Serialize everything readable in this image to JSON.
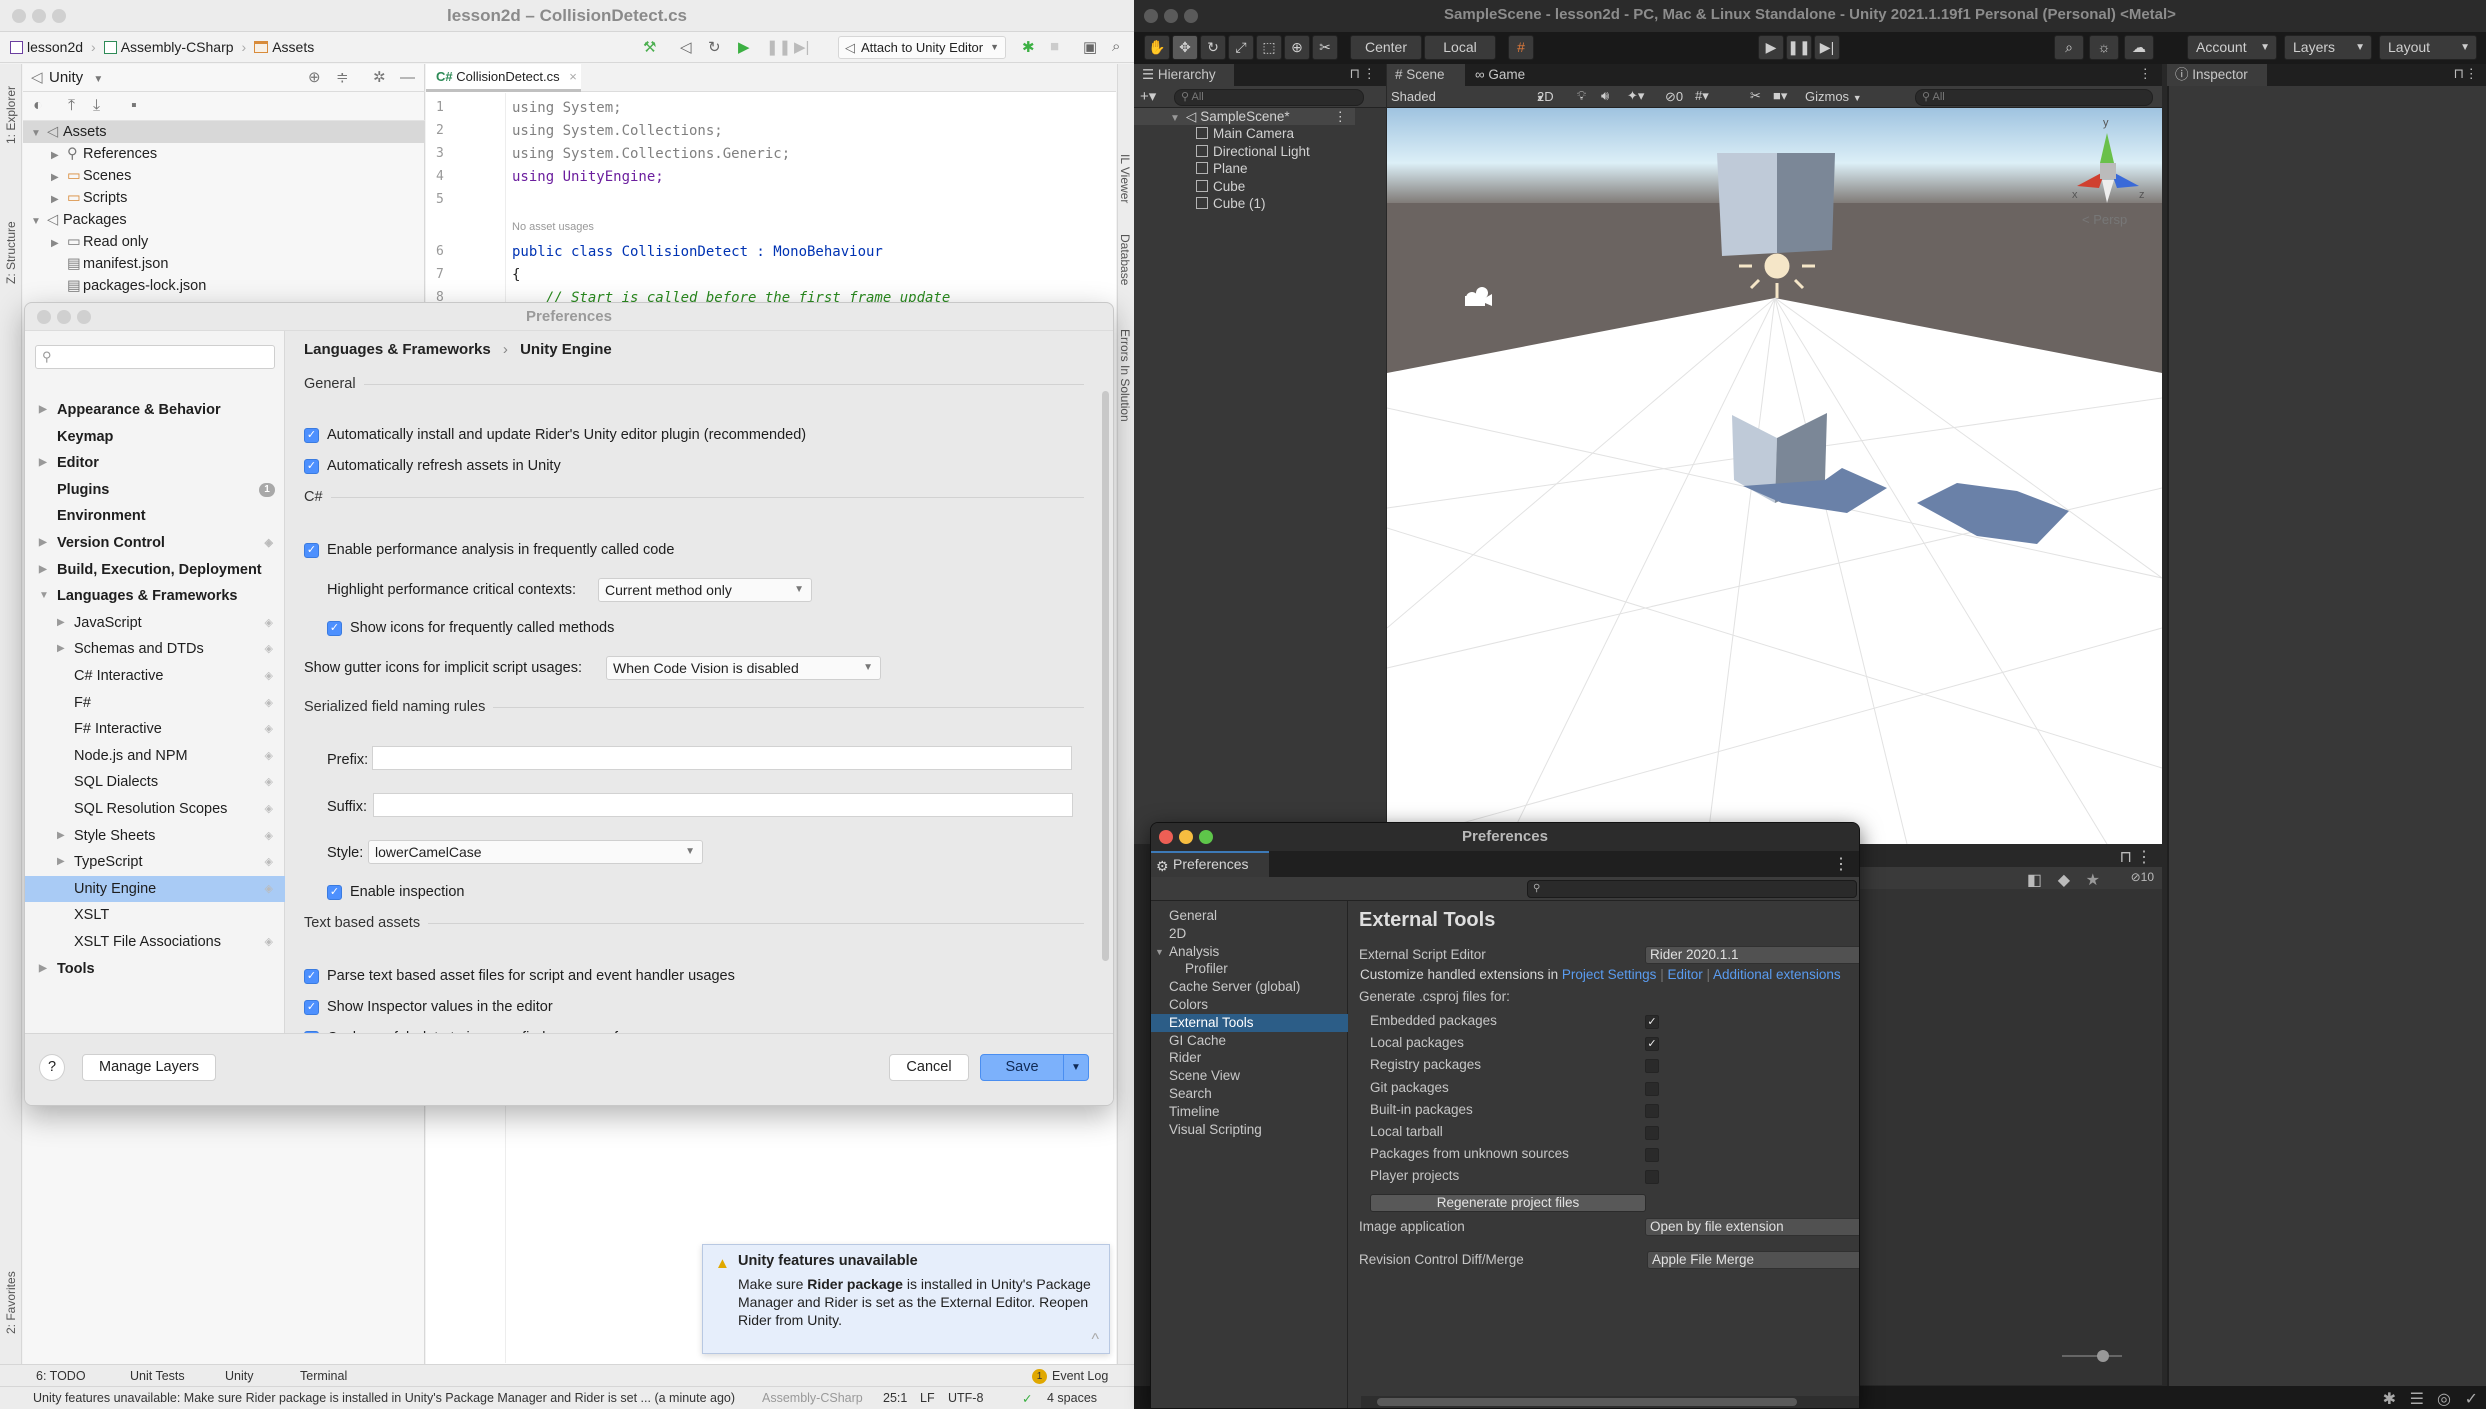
{
  "rider": {
    "window_title": "lesson2d – CollisionDetect.cs",
    "breadcrumb": [
      "lesson2d",
      "Assembly-CSharp",
      "Assets"
    ],
    "toolbar": {
      "attach_label": "Attach to Unity Editor"
    },
    "left_stripe": {
      "explorer": "1: Explorer",
      "structure": "Z: Structure",
      "favorites": "2: Favorites"
    },
    "right_stripe": {
      "il_viewer": "IL Viewer",
      "database": "Database",
      "errors": "Errors In Solution"
    },
    "explorer": {
      "view_label": "Unity",
      "tree": [
        {
          "label": "Assets",
          "level": 0,
          "expanded": true,
          "selected": true
        },
        {
          "label": "References",
          "level": 1,
          "expandable": true
        },
        {
          "label": "Scenes",
          "level": 1,
          "expandable": true
        },
        {
          "label": "Scripts",
          "level": 1,
          "expandable": true
        },
        {
          "label": "Packages",
          "level": 0,
          "expanded": true
        },
        {
          "label": "Read only",
          "level": 1,
          "expandable": true
        },
        {
          "label": "manifest.json",
          "level": 1
        },
        {
          "label": "packages-lock.json",
          "level": 1
        }
      ]
    },
    "editor": {
      "tab_label": "CollisionDetect.cs",
      "lines": [
        {
          "n": "1",
          "text": "using System;"
        },
        {
          "n": "2",
          "text": "using System.Collections;"
        },
        {
          "n": "3",
          "text": "using System.Collections.Generic;"
        },
        {
          "n": "4",
          "text": "using UnityEngine;"
        },
        {
          "n": "5",
          "text": ""
        },
        {
          "n": "6",
          "text": "public class CollisionDetect : MonoBehaviour"
        },
        {
          "n": "7",
          "text": "{"
        },
        {
          "n": "8",
          "text": "    // Start is called before the first frame update"
        }
      ],
      "code_vision_hint": "No asset usages"
    },
    "tool_windows": [
      "6: TODO",
      "Unit Tests",
      "Unity",
      "Terminal"
    ],
    "event_log": {
      "label": "Event Log",
      "count": "1"
    },
    "status": {
      "message": "Unity features unavailable: Make sure Rider package is installed in Unity's Package Manager and  Rider is set ... (a minute ago)",
      "project": "Assembly-CSharp",
      "position": "25:1",
      "line_ending": "LF",
      "encoding": "UTF-8",
      "indent": "4 spaces"
    },
    "notification": {
      "title": "Unity features unavailable",
      "body_pre": "Make sure ",
      "body_bold": "Rider package",
      "body_post": " is installed in Unity's Package Manager and Rider is set as the External Editor. Reopen Rider from Unity."
    }
  },
  "rider_prefs": {
    "title": "Preferences",
    "search_placeholder": "Q̱",
    "breadcrumb": {
      "parent": "Languages & Frameworks",
      "sep": "›",
      "current": "Unity Engine"
    },
    "nav": [
      {
        "label": "Appearance & Behavior",
        "bold": true,
        "arrow": true
      },
      {
        "label": "Keymap",
        "bold": true
      },
      {
        "label": "Editor",
        "bold": true,
        "arrow": true
      },
      {
        "label": "Plugins",
        "bold": true,
        "badge": "1"
      },
      {
        "label": "Environment",
        "bold": true
      },
      {
        "label": "Version Control",
        "bold": true,
        "arrow": true,
        "side": true
      },
      {
        "label": "Build, Execution, Deployment",
        "bold": true,
        "arrow": true
      },
      {
        "label": "Languages & Frameworks",
        "bold": true,
        "arrow": "down"
      },
      {
        "label": "JavaScript",
        "indent": true,
        "arrow": true,
        "side": true
      },
      {
        "label": "Schemas and DTDs",
        "indent": true,
        "arrow": true,
        "side": true
      },
      {
        "label": "C# Interactive",
        "indent": true,
        "side": true
      },
      {
        "label": "F#",
        "indent": true,
        "side": true
      },
      {
        "label": "F# Interactive",
        "indent": true,
        "side": true
      },
      {
        "label": "Node.js and NPM",
        "indent": true,
        "side": true
      },
      {
        "label": "SQL Dialects",
        "indent": true,
        "side": true
      },
      {
        "label": "SQL Resolution Scopes",
        "indent": true,
        "side": true
      },
      {
        "label": "Style Sheets",
        "indent": true,
        "arrow": true,
        "side": true
      },
      {
        "label": "TypeScript",
        "indent": true,
        "arrow": true,
        "side": true
      },
      {
        "label": "Unity Engine",
        "indent": true,
        "side": true,
        "selected": true
      },
      {
        "label": "XSLT",
        "indent": true
      },
      {
        "label": "XSLT File Associations",
        "indent": true,
        "side": true
      },
      {
        "label": "Tools",
        "bold": true,
        "arrow": true
      }
    ],
    "sections": {
      "general": "General",
      "csharp": "C#",
      "naming": "Serialized field naming rules",
      "text_assets": "Text based assets"
    },
    "options": {
      "auto_install_plugin": {
        "label": "Automatically install and update Rider's Unity editor plugin (recommended)",
        "checked": true
      },
      "auto_refresh": {
        "label": "Automatically refresh assets in Unity",
        "checked": true
      },
      "perf_analysis": {
        "label": "Enable performance analysis in frequently called code",
        "checked": true
      },
      "highlight_label": "Highlight performance critical contexts:",
      "highlight_value": "Current method only",
      "show_icons": {
        "label": "Show icons for frequently called methods",
        "checked": true
      },
      "gutter_label": "Show gutter icons for implicit script usages:",
      "gutter_value": "When Code Vision is disabled",
      "prefix_label": "Prefix:",
      "prefix_value": "",
      "suffix_label": "Suffix:",
      "suffix_value": "",
      "style_label": "Style:",
      "style_value": "lowerCamelCase",
      "enable_inspection": {
        "label": "Enable inspection",
        "checked": true
      },
      "parse_text": {
        "label": "Parse text based asset files for script and event handler usages",
        "checked": true
      },
      "inspector_values": {
        "label": "Show Inspector values in the editor",
        "checked": true
      },
      "cache_prefab": {
        "label": "Cache prefab data to improve find usage performance",
        "checked": true
      }
    },
    "footer": {
      "help": "?",
      "manage_layers": "Manage Layers",
      "cancel": "Cancel",
      "save": "Save"
    }
  },
  "unity": {
    "window_title": "SampleScene - lesson2d - PC, Mac & Linux Standalone - Unity 2021.1.19f1 Personal (Personal) <Metal>",
    "toolbar": {
      "center": "Center",
      "local": "Local",
      "account": "Account",
      "layers": "Layers",
      "layout": "Layout"
    },
    "hierarchy": {
      "tab": "Hierarchy",
      "search_placeholder": "All",
      "scene": "SampleScene*",
      "objects": [
        "Main Camera",
        "Directional Light",
        "Plane",
        "Cube",
        "Cube (1)"
      ]
    },
    "scene_tabs": [
      "Scene",
      "Game"
    ],
    "scene_toolbar": {
      "shading": "Shaded",
      "mode_2d": "2D",
      "hidden_count": "0",
      "gizmos": "Gizmos",
      "search_placeholder": "All"
    },
    "scene_view": {
      "projection": "Persp",
      "axis_x": "x",
      "axis_y": "y",
      "axis_z": "z"
    },
    "inspector_tab": "Inspector",
    "project_hidden_count": "10"
  },
  "unity_prefs": {
    "title": "Preferences",
    "tab": "Preferences",
    "nav": [
      {
        "label": "General"
      },
      {
        "label": "2D"
      },
      {
        "label": "Analysis",
        "expanded": true
      },
      {
        "label": "Profiler",
        "sub": true
      },
      {
        "label": "Cache Server (global)"
      },
      {
        "label": "Colors"
      },
      {
        "label": "External Tools",
        "selected": true
      },
      {
        "label": "GI Cache"
      },
      {
        "label": "Rider"
      },
      {
        "label": "Scene View"
      },
      {
        "label": "Search"
      },
      {
        "label": "Timeline"
      },
      {
        "label": "Visual Scripting"
      }
    ],
    "heading": "External Tools",
    "script_editor_label": "External Script Editor",
    "script_editor_value": "Rider 2020.1.1",
    "customize_label": "Customize handled extensions in",
    "links": [
      "Project Settings",
      "Editor",
      "Additional extensions"
    ],
    "generate_label": "Generate .csproj files for:",
    "csproj_options": [
      {
        "label": "Embedded packages",
        "checked": true
      },
      {
        "label": "Local packages",
        "checked": true
      },
      {
        "label": "Registry packages",
        "checked": false
      },
      {
        "label": "Git packages",
        "checked": false
      },
      {
        "label": "Built-in packages",
        "checked": false
      },
      {
        "label": "Local tarball",
        "checked": false
      },
      {
        "label": "Packages from unknown sources",
        "checked": false
      },
      {
        "label": "Player projects",
        "checked": false
      }
    ],
    "regenerate_label": "Regenerate project files",
    "image_app_label": "Image application",
    "image_app_value": "Open by file extension",
    "diff_label": "Revision Control Diff/Merge",
    "diff_value": "Apple File Merge"
  },
  "colors": {
    "rider_accent": "#4d90fe",
    "rider_selection": "#a9cbf5",
    "unity_selection": "#2c5d87",
    "unity_link": "#5a9cf0",
    "warning": "#e0a800"
  }
}
